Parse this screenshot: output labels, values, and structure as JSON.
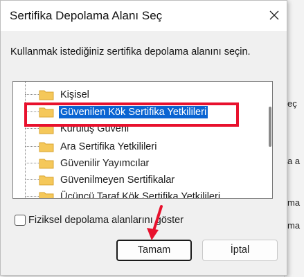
{
  "dialog": {
    "title": "Sertifika Depolama Alanı Seç",
    "description": "Kullanmak istediğiniz sertifika depolama alanını seçin.",
    "stores": [
      {
        "label": "Kişisel",
        "selected": false
      },
      {
        "label": "Güvenilen Kök Sertifika Yetkilileri",
        "selected": true
      },
      {
        "label": "Kuruluş Güveni",
        "selected": false
      },
      {
        "label": "Ara Sertifika Yetkilileri",
        "selected": false
      },
      {
        "label": "Güvenilir Yayımcılar",
        "selected": false
      },
      {
        "label": "Güvenilmeyen Sertifikalar",
        "selected": false
      },
      {
        "label": "Üçüncü Taraf Kök Sertifika Yetkilileri",
        "selected": false
      }
    ],
    "show_physical_label": "Fiziksel depolama alanlarını göster",
    "show_physical_checked": false,
    "ok_label": "Tamam",
    "cancel_label": "İptal"
  },
  "background_fragments": [
    "eç",
    "a a",
    "ma",
    "ma"
  ],
  "colors": {
    "selection": "#0a64d2",
    "annotation": "#e8112d",
    "folder": "#f5c85a"
  }
}
